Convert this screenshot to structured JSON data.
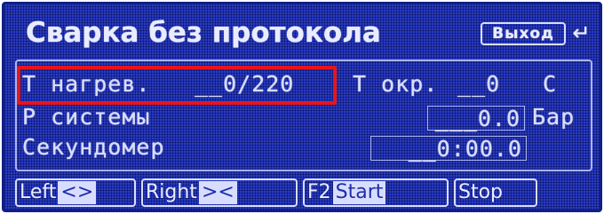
{
  "header": {
    "title": "Сварка без протокола",
    "exit_label": "Выход",
    "return_glyph": "↵"
  },
  "rows": {
    "heat_label": "Т нагрев.",
    "heat_value": "__0/220",
    "ambient_label": "Т окр.",
    "ambient_value": "__0",
    "ambient_unit": "С",
    "pressure_label": "Р системы",
    "pressure_value": "___0.0",
    "pressure_unit": "Бар",
    "timer_label": "Секундомер",
    "timer_value": "__0:00.0"
  },
  "fkeys": {
    "left_label": "Left",
    "left_glyph": "<>",
    "right_label": "Right",
    "right_glyph": "><",
    "f2_label": "F2",
    "start_label": "Start",
    "stop_label": "Stop"
  },
  "colors": {
    "screen_bg": "#2a3cc6",
    "text": "#d8ddff",
    "highlight": "#e8141c"
  }
}
